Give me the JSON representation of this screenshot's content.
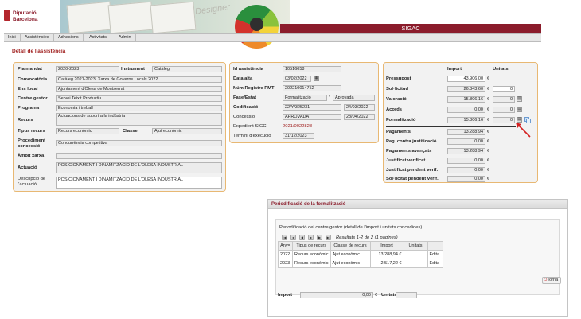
{
  "header": {
    "logo_line1": "Diputació",
    "logo_line2": "Barcelona",
    "banner_word": "Designer",
    "app_title": "SIGAC"
  },
  "menu": [
    "Inici",
    "Assistències",
    "Adhesions",
    "Activitats",
    "Admin"
  ],
  "page_title": "Detall de l'assistència",
  "left_panel": {
    "pla_mandat_label": "Pla mandat",
    "pla_mandat": "2020-2023",
    "instrument_label": "Instrument",
    "instrument": "Catàleg",
    "convocatoria_label": "Convocatòria",
    "convocatoria": "Catàleg 2021-2023: Xarxa de Governs Locals 2022",
    "ens_local_label": "Ens local",
    "ens_local": "Ajuntament d'Olesa de Montserrat",
    "centre_gestor_label": "Centre gestor",
    "centre_gestor": "Servei Teixit Productiu",
    "programa_label": "Programa",
    "programa": "Economia i treball",
    "recurs_label": "Recurs",
    "recurs": "Actuacions de suport a la indústria",
    "tipus_recurs_label": "Tipus recurs",
    "tipus_recurs": "Recurs econòmic",
    "classe_label": "Classe",
    "classe": "Ajut econòmic",
    "procediment_label_1": "Procediment",
    "procediment_label_2": "concessió",
    "procediment": "Concurrència competitiva",
    "ambit_label": "Àmbit xarxa",
    "actuacio_label": "Actuació",
    "actuacio": "POSICIONAMENT I DINAMITZACIÓ DE L'OLESA INDUSTRIAL",
    "descripcio_label_1": "Descripció de",
    "descripcio_label_2": "l'actuació",
    "descripcio": "POSICIONAMENT I DINAMITZACIÓ DE L'OLESA INDUSTRIAL"
  },
  "mid_panel": {
    "id_label": "Id assistència",
    "id": "10516058",
    "data_alta_label": "Data alta",
    "data_alta": "03/02/2022",
    "num_registre_label": "Núm Registre PMT",
    "num_registre": "202210014752",
    "fase_label": "Fase/Estat",
    "fase": "Formalització",
    "estat": "Aprovada",
    "fase_sep": "/",
    "codificacio_label": "Codificació",
    "codificacio": "22/Y/325231",
    "codificacio_data": "24/03/2022",
    "concessio_label": "Concessió",
    "concessio": "APROVADA",
    "concessio_data": "28/04/2022",
    "expedient_label": "Expedient SIGC",
    "expedient": "2021/0022828",
    "termini_label": "Termini d'execució",
    "termini": "31/12/2023"
  },
  "right_panel": {
    "col_import": "Import",
    "col_unitats": "Unitats",
    "rows_top": [
      {
        "label": "Pressupost",
        "import": "43.906,00",
        "unitats": null
      },
      {
        "label": "Sol·licitud",
        "import": "26.343,60",
        "unitats": "0"
      },
      {
        "label": "Valoració",
        "import": "15.806,16",
        "unitats": "0"
      },
      {
        "label": "Acords",
        "import": "0,00",
        "unitats": "0"
      },
      {
        "label": "Formalització",
        "import": "15.806,16",
        "unitats": "0"
      }
    ],
    "rows_bottom": [
      {
        "label": "Pagaments",
        "import": "13.288,94"
      },
      {
        "label": "Pag. contra justificació",
        "import": "0,00"
      },
      {
        "label": "Pagaments avançats",
        "import": "13.288,94"
      },
      {
        "label": "Justificat verificat",
        "import": "0,00"
      },
      {
        "label": "Justificat pendent verif.",
        "import": "0,00"
      },
      {
        "label": "Sol·licitat pendent verif.",
        "import": "0,00"
      }
    ],
    "currency": "€"
  },
  "periodificacio": {
    "window_title": "Periodificació de la formalització",
    "description": "Periodificació del centre gestor (detall de l'import i unitats concedides)",
    "results": "Resultats 1-2 de 2 (1 pàgines)",
    "columns": [
      "Any",
      "Tipus de recurs",
      "Classe de recurs",
      "Import",
      "Unitats",
      ""
    ],
    "sort_marker": "=",
    "rows": [
      {
        "any": "2022",
        "tipus": "Recurs econòmic",
        "classe": "Ajut econòmic",
        "import": "13.288,94 €",
        "unitats": "",
        "accio": "Edita"
      },
      {
        "any": "2023",
        "tipus": "Recurs econòmic",
        "classe": "Ajut econòmic",
        "import": "2.517,22 €",
        "unitats": "",
        "accio": "Edita"
      }
    ],
    "torna": "Torna",
    "import_label": "Import",
    "import_value": "0,00",
    "unitats_label": "Unitats"
  }
}
